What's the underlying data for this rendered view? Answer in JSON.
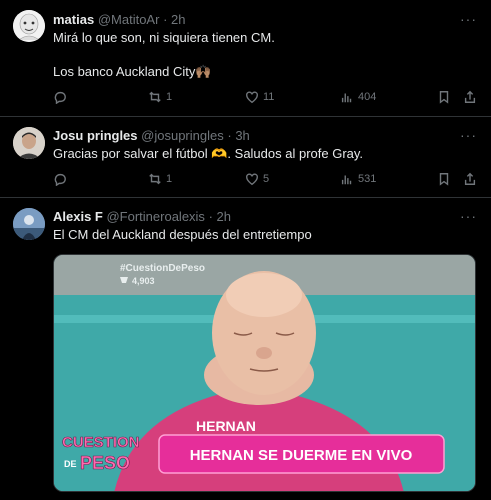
{
  "tweets": [
    {
      "name": "matias",
      "handle": "@MatitoAr",
      "dot": "·",
      "time": "2h",
      "lines": [
        "Mirá lo que son, ni siquiera tienen CM.",
        "",
        "Los banco Auckland City🙌🏽"
      ],
      "stats": {
        "reply": "",
        "retweet": "1",
        "like": "11",
        "views": "404"
      }
    },
    {
      "name": "Josu pringles",
      "handle": "@josupringles",
      "dot": "·",
      "time": "3h",
      "lines": [
        "Gracias por salvar el fútbol 🫶. Saludos al profe Gray."
      ],
      "stats": {
        "reply": "",
        "retweet": "1",
        "like": "5",
        "views": "531"
      }
    },
    {
      "name": "Alexis F",
      "handle": "@Fortineroalexis",
      "dot": "·",
      "time": "2h",
      "lines": [
        "El CM del Auckland después del entretiempo"
      ],
      "media": {
        "hashtag": "#CuestionDePeso",
        "tweet_count": "4,903",
        "shirt_text": "HERNAN",
        "logo_line1": "CUESTION",
        "logo_prefix": "DE",
        "logo_line2": "PESO",
        "banner": "HERNAN SE DUERME EN VIVO"
      }
    }
  ],
  "icons": {
    "more": "more-icon",
    "reply": "reply-icon",
    "retweet": "retweet-icon",
    "like": "like-icon",
    "views": "views-icon",
    "bookmark": "bookmark-icon",
    "share": "share-icon"
  },
  "colors": {
    "background": "#000000",
    "text": "#e7e9ea",
    "secondary": "#71767b",
    "divider": "#2f3336",
    "banner_pink": "#e62e9a"
  }
}
